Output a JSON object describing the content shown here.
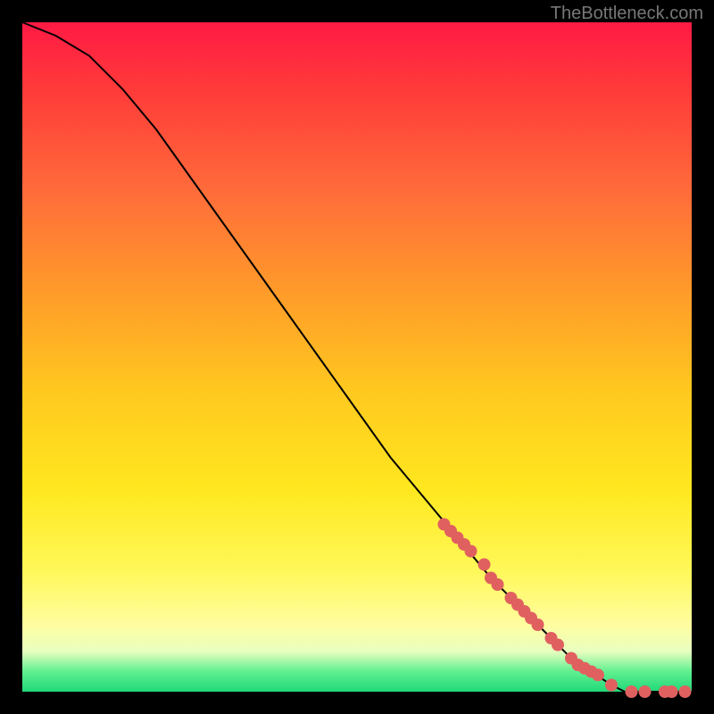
{
  "watermark": "TheBottleneck.com",
  "chart_data": {
    "type": "line",
    "title": "",
    "xlabel": "",
    "ylabel": "",
    "xlim": [
      0,
      100
    ],
    "ylim": [
      0,
      100
    ],
    "curve": {
      "name": "bottleneck-curve",
      "x": [
        0,
        5,
        10,
        15,
        20,
        25,
        30,
        35,
        40,
        45,
        50,
        55,
        60,
        65,
        70,
        75,
        80,
        82,
        85,
        88,
        90,
        95,
        100
      ],
      "y": [
        100,
        98,
        95,
        90,
        84,
        77,
        70,
        63,
        56,
        49,
        42,
        35,
        29,
        23,
        17,
        12,
        7,
        5,
        3,
        1,
        0,
        0,
        0
      ]
    },
    "markers": {
      "name": "highlight-points",
      "color": "#e06060",
      "x": [
        63,
        64,
        65,
        66,
        67,
        69,
        70,
        71,
        73,
        74,
        75,
        76,
        77,
        79,
        80,
        82,
        83,
        84,
        85,
        86,
        88,
        91,
        93,
        96,
        97,
        99
      ],
      "y": [
        25,
        24,
        23,
        22,
        21,
        19,
        17,
        16,
        14,
        13,
        12,
        11,
        10,
        8,
        7,
        5,
        4,
        3.5,
        3,
        2.5,
        1,
        0,
        0,
        0,
        0,
        0
      ]
    }
  }
}
